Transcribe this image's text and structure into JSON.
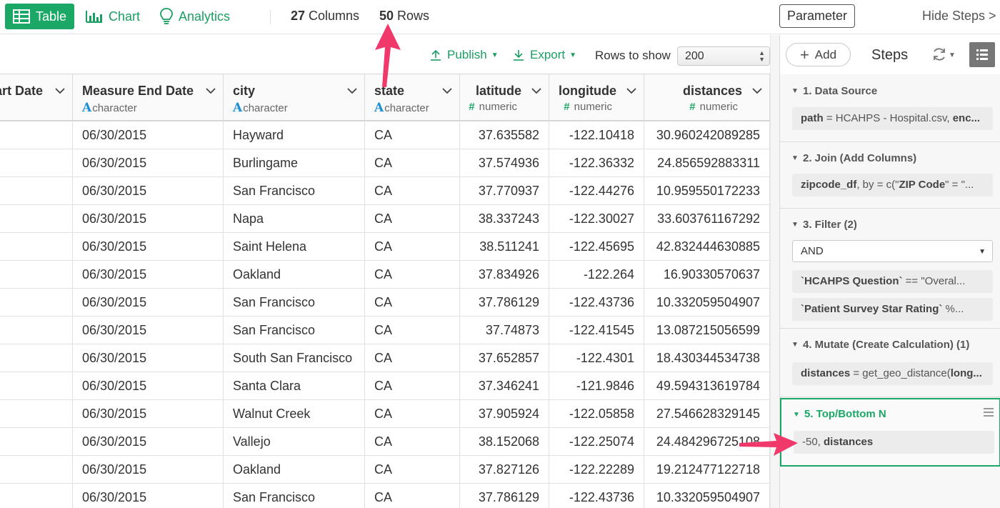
{
  "toolbar_top": {
    "table_label": "Table",
    "chart_label": "Chart",
    "analytics_label": "Analytics",
    "columns_count": "27",
    "columns_label": " Columns",
    "rows_count": "50",
    "rows_label": " Rows",
    "parameter_label": "Parameter",
    "hide_steps_label": "Hide Steps >"
  },
  "table_toolbar": {
    "publish_label": "Publish",
    "export_label": "Export",
    "rows_to_show_label": "Rows to show",
    "rows_to_show_value": "200"
  },
  "columns": [
    {
      "name": "art Date",
      "type": ""
    },
    {
      "name": "Measure End Date",
      "type": "character"
    },
    {
      "name": "city",
      "type": "character"
    },
    {
      "name": "state",
      "type": "character"
    },
    {
      "name": "latitude",
      "type": "numeric"
    },
    {
      "name": "longitude",
      "type": "numeric"
    },
    {
      "name": "distances",
      "type": "numeric"
    }
  ],
  "rows": [
    [
      "",
      "06/30/2015",
      "Hayward",
      "CA",
      "37.635582",
      "-122.10418",
      "30.960242089285"
    ],
    [
      "",
      "06/30/2015",
      "Burlingame",
      "CA",
      "37.574936",
      "-122.36332",
      "24.856592883311"
    ],
    [
      "",
      "06/30/2015",
      "San Francisco",
      "CA",
      "37.770937",
      "-122.44276",
      "10.959550172233"
    ],
    [
      "",
      "06/30/2015",
      "Napa",
      "CA",
      "38.337243",
      "-122.30027",
      "33.603761167292"
    ],
    [
      "",
      "06/30/2015",
      "Saint Helena",
      "CA",
      "38.511241",
      "-122.45695",
      "42.832444630885"
    ],
    [
      "",
      "06/30/2015",
      "Oakland",
      "CA",
      "37.834926",
      "-122.264",
      "16.90330570637"
    ],
    [
      "",
      "06/30/2015",
      "San Francisco",
      "CA",
      "37.786129",
      "-122.43736",
      "10.332059504907"
    ],
    [
      "",
      "06/30/2015",
      "San Francisco",
      "CA",
      "37.74873",
      "-122.41545",
      "13.087215056599"
    ],
    [
      "",
      "06/30/2015",
      "South San Francisco",
      "CA",
      "37.652857",
      "-122.4301",
      "18.430344534738"
    ],
    [
      "",
      "06/30/2015",
      "Santa Clara",
      "CA",
      "37.346241",
      "-121.9846",
      "49.594313619784"
    ],
    [
      "",
      "06/30/2015",
      "Walnut Creek",
      "CA",
      "37.905924",
      "-122.05858",
      "27.546628329145"
    ],
    [
      "",
      "06/30/2015",
      "Vallejo",
      "CA",
      "38.152068",
      "-122.25074",
      "24.484296725108"
    ],
    [
      "",
      "06/30/2015",
      "Oakland",
      "CA",
      "37.827126",
      "-122.22289",
      "19.212477122718"
    ],
    [
      "",
      "06/30/2015",
      "San Francisco",
      "CA",
      "37.786129",
      "-122.43736",
      "10.332059504907"
    ]
  ],
  "steps_panel": {
    "add_label": "Add",
    "title": "Steps",
    "steps": [
      {
        "title": "1. Data Source",
        "body_key": "path",
        "body_rest": " = HCAHPS - Hospital.csv, ",
        "body_key2": "enc..."
      },
      {
        "title": "2. Join (Add Columns)",
        "body_key": "zipcode_df",
        "body_rest": ", by = c(\"",
        "body_key2": "ZIP Code",
        "body_tail": "\" = \"..."
      },
      {
        "title": "3. Filter (2)",
        "and_label": "AND",
        "cond1_key": "`HCAHPS Question`",
        "cond1_rest": " == \"Overal...",
        "cond2_key": "`Patient Survey Star Rating`",
        "cond2_rest": " %..."
      },
      {
        "title": "4. Mutate (Create Calculation) (1)",
        "body_key": "distances",
        "body_rest": " = get_geo_distance(",
        "body_key2": "long..."
      },
      {
        "title": "5. Top/Bottom N",
        "body_rest": "-50, ",
        "body_key": "distances"
      }
    ]
  },
  "colors": {
    "accent_green": "#1ba866",
    "type_blue": "#1a8fd6",
    "annotation_pink": "#f0386b"
  }
}
